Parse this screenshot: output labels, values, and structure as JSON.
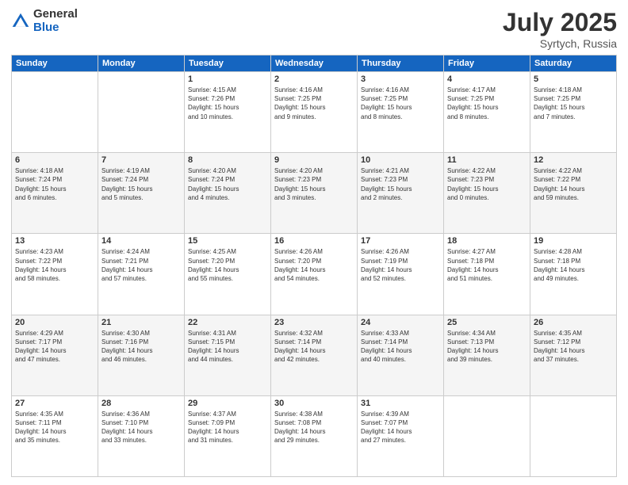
{
  "logo": {
    "general": "General",
    "blue": "Blue"
  },
  "title": {
    "month": "July 2025",
    "location": "Syrtych, Russia"
  },
  "days_header": [
    "Sunday",
    "Monday",
    "Tuesday",
    "Wednesday",
    "Thursday",
    "Friday",
    "Saturday"
  ],
  "weeks": [
    [
      {
        "day": "",
        "info": ""
      },
      {
        "day": "",
        "info": ""
      },
      {
        "day": "1",
        "info": "Sunrise: 4:15 AM\nSunset: 7:26 PM\nDaylight: 15 hours\nand 10 minutes."
      },
      {
        "day": "2",
        "info": "Sunrise: 4:16 AM\nSunset: 7:25 PM\nDaylight: 15 hours\nand 9 minutes."
      },
      {
        "day": "3",
        "info": "Sunrise: 4:16 AM\nSunset: 7:25 PM\nDaylight: 15 hours\nand 8 minutes."
      },
      {
        "day": "4",
        "info": "Sunrise: 4:17 AM\nSunset: 7:25 PM\nDaylight: 15 hours\nand 8 minutes."
      },
      {
        "day": "5",
        "info": "Sunrise: 4:18 AM\nSunset: 7:25 PM\nDaylight: 15 hours\nand 7 minutes."
      }
    ],
    [
      {
        "day": "6",
        "info": "Sunrise: 4:18 AM\nSunset: 7:24 PM\nDaylight: 15 hours\nand 6 minutes."
      },
      {
        "day": "7",
        "info": "Sunrise: 4:19 AM\nSunset: 7:24 PM\nDaylight: 15 hours\nand 5 minutes."
      },
      {
        "day": "8",
        "info": "Sunrise: 4:20 AM\nSunset: 7:24 PM\nDaylight: 15 hours\nand 4 minutes."
      },
      {
        "day": "9",
        "info": "Sunrise: 4:20 AM\nSunset: 7:23 PM\nDaylight: 15 hours\nand 3 minutes."
      },
      {
        "day": "10",
        "info": "Sunrise: 4:21 AM\nSunset: 7:23 PM\nDaylight: 15 hours\nand 2 minutes."
      },
      {
        "day": "11",
        "info": "Sunrise: 4:22 AM\nSunset: 7:23 PM\nDaylight: 15 hours\nand 0 minutes."
      },
      {
        "day": "12",
        "info": "Sunrise: 4:22 AM\nSunset: 7:22 PM\nDaylight: 14 hours\nand 59 minutes."
      }
    ],
    [
      {
        "day": "13",
        "info": "Sunrise: 4:23 AM\nSunset: 7:22 PM\nDaylight: 14 hours\nand 58 minutes."
      },
      {
        "day": "14",
        "info": "Sunrise: 4:24 AM\nSunset: 7:21 PM\nDaylight: 14 hours\nand 57 minutes."
      },
      {
        "day": "15",
        "info": "Sunrise: 4:25 AM\nSunset: 7:20 PM\nDaylight: 14 hours\nand 55 minutes."
      },
      {
        "day": "16",
        "info": "Sunrise: 4:26 AM\nSunset: 7:20 PM\nDaylight: 14 hours\nand 54 minutes."
      },
      {
        "day": "17",
        "info": "Sunrise: 4:26 AM\nSunset: 7:19 PM\nDaylight: 14 hours\nand 52 minutes."
      },
      {
        "day": "18",
        "info": "Sunrise: 4:27 AM\nSunset: 7:18 PM\nDaylight: 14 hours\nand 51 minutes."
      },
      {
        "day": "19",
        "info": "Sunrise: 4:28 AM\nSunset: 7:18 PM\nDaylight: 14 hours\nand 49 minutes."
      }
    ],
    [
      {
        "day": "20",
        "info": "Sunrise: 4:29 AM\nSunset: 7:17 PM\nDaylight: 14 hours\nand 47 minutes."
      },
      {
        "day": "21",
        "info": "Sunrise: 4:30 AM\nSunset: 7:16 PM\nDaylight: 14 hours\nand 46 minutes."
      },
      {
        "day": "22",
        "info": "Sunrise: 4:31 AM\nSunset: 7:15 PM\nDaylight: 14 hours\nand 44 minutes."
      },
      {
        "day": "23",
        "info": "Sunrise: 4:32 AM\nSunset: 7:14 PM\nDaylight: 14 hours\nand 42 minutes."
      },
      {
        "day": "24",
        "info": "Sunrise: 4:33 AM\nSunset: 7:14 PM\nDaylight: 14 hours\nand 40 minutes."
      },
      {
        "day": "25",
        "info": "Sunrise: 4:34 AM\nSunset: 7:13 PM\nDaylight: 14 hours\nand 39 minutes."
      },
      {
        "day": "26",
        "info": "Sunrise: 4:35 AM\nSunset: 7:12 PM\nDaylight: 14 hours\nand 37 minutes."
      }
    ],
    [
      {
        "day": "27",
        "info": "Sunrise: 4:35 AM\nSunset: 7:11 PM\nDaylight: 14 hours\nand 35 minutes."
      },
      {
        "day": "28",
        "info": "Sunrise: 4:36 AM\nSunset: 7:10 PM\nDaylight: 14 hours\nand 33 minutes."
      },
      {
        "day": "29",
        "info": "Sunrise: 4:37 AM\nSunset: 7:09 PM\nDaylight: 14 hours\nand 31 minutes."
      },
      {
        "day": "30",
        "info": "Sunrise: 4:38 AM\nSunset: 7:08 PM\nDaylight: 14 hours\nand 29 minutes."
      },
      {
        "day": "31",
        "info": "Sunrise: 4:39 AM\nSunset: 7:07 PM\nDaylight: 14 hours\nand 27 minutes."
      },
      {
        "day": "",
        "info": ""
      },
      {
        "day": "",
        "info": ""
      }
    ]
  ]
}
